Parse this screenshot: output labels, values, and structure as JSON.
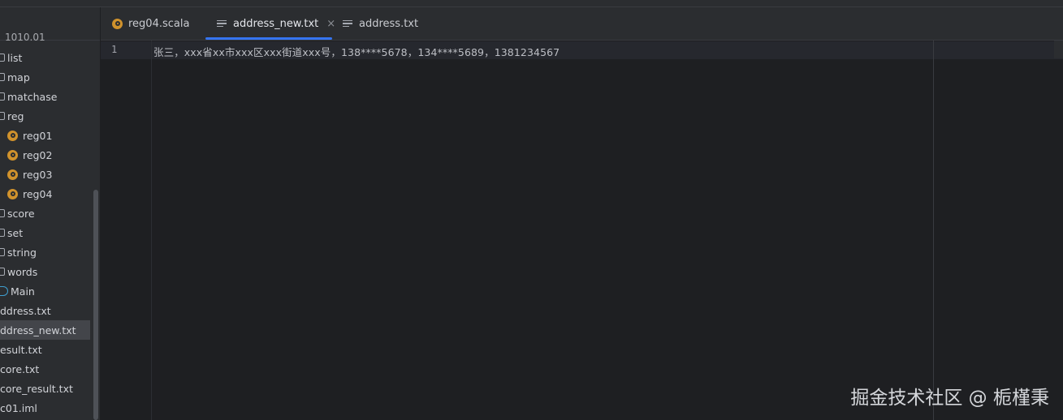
{
  "project_tree": {
    "clipped_top_label": "1010.01",
    "items": [
      {
        "label": "list",
        "icon": "folder-icon"
      },
      {
        "label": "map",
        "icon": "folder-icon"
      },
      {
        "label": "matchase",
        "icon": "folder-icon"
      },
      {
        "label": "reg",
        "icon": "folder-icon"
      },
      {
        "label": "reg01",
        "icon": "scala-object-icon"
      },
      {
        "label": "reg02",
        "icon": "scala-object-icon"
      },
      {
        "label": "reg03",
        "icon": "scala-object-icon"
      },
      {
        "label": "reg04",
        "icon": "scala-object-icon"
      },
      {
        "label": "score",
        "icon": "folder-icon"
      },
      {
        "label": "set",
        "icon": "folder-icon"
      },
      {
        "label": "string",
        "icon": "folder-icon"
      },
      {
        "label": "words",
        "icon": "folder-icon"
      },
      {
        "label": "Main",
        "icon": "main-icon"
      },
      {
        "label": "ddress.txt",
        "icon": "none"
      },
      {
        "label": "ddress_new.txt",
        "icon": "none",
        "selected": true
      },
      {
        "label": "esult.txt",
        "icon": "none"
      },
      {
        "label": "core.txt",
        "icon": "none"
      },
      {
        "label": "core_result.txt",
        "icon": "none"
      },
      {
        "label": "c01.iml",
        "icon": "none"
      }
    ]
  },
  "tabs": [
    {
      "label": "reg04.scala",
      "icon": "scala-object-icon",
      "active": false
    },
    {
      "label": "address_new.txt",
      "icon": "text-file-icon",
      "active": true,
      "close": "×"
    },
    {
      "label": "address.txt",
      "icon": "text-file-icon",
      "active": false
    }
  ],
  "editor": {
    "line_numbers": [
      "1"
    ],
    "lines": [
      "张三，xxx省xx市xxx区xxx街道xxx号，138****5678，134****5689，1381234567"
    ]
  },
  "watermark": "掘金技术社区 @ 栀槿秉",
  "colors": {
    "background": "#1e1f22",
    "panel": "#2b2d30",
    "accent_underline": "#3574f0",
    "scala_icon": "#d0922c"
  }
}
